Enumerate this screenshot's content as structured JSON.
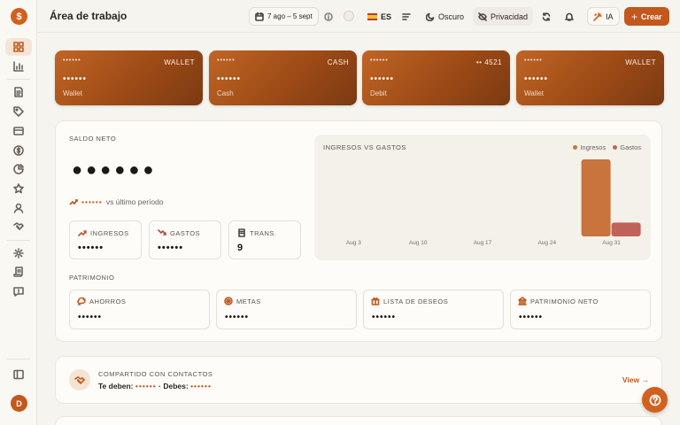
{
  "app": {
    "logo_glyph": "$",
    "user_initial": "D"
  },
  "sidebar": {
    "items": [
      {
        "name": "dashboard",
        "icon": "grid-icon",
        "active": true
      },
      {
        "name": "reports",
        "icon": "bar-chart-icon"
      },
      {
        "name": "transactions",
        "icon": "document-icon"
      },
      {
        "name": "tags",
        "icon": "tag-icon"
      },
      {
        "name": "accounts",
        "icon": "inbox-icon"
      },
      {
        "name": "budget",
        "icon": "dollar-icon"
      },
      {
        "name": "analytics",
        "icon": "pie-icon"
      },
      {
        "name": "favorites",
        "icon": "star-icon"
      },
      {
        "name": "contacts",
        "icon": "user-icon"
      },
      {
        "name": "split",
        "icon": "handshake-icon"
      },
      {
        "name": "settings",
        "icon": "gear-icon"
      },
      {
        "name": "rules",
        "icon": "scroll-icon"
      },
      {
        "name": "feedback",
        "icon": "message-icon"
      }
    ]
  },
  "header": {
    "title": "Área de trabajo",
    "date_range": "7 ago – 5 sept",
    "language": "ES",
    "theme_label": "Oscuro",
    "privacy_label": "Privacidad",
    "ai_label": "IA",
    "create_label": "Crear"
  },
  "cards": [
    {
      "top_mask": "••••••",
      "type": "WALLET",
      "balance": "••••••",
      "name": "Wallet"
    },
    {
      "top_mask": "••••••",
      "type": "CASH",
      "balance": "••••••",
      "name": "Cash"
    },
    {
      "top_mask": "••••••",
      "type": "•• 4521",
      "balance": "••••••",
      "name": "Debit"
    },
    {
      "top_mask": "••••••",
      "type": "WALLET",
      "balance": "••••••",
      "name": "Wallet"
    }
  ],
  "net_balance": {
    "label": "SALDO NETO",
    "value": "●●●●●●",
    "trend_value": "••••••",
    "trend_text": "vs último período"
  },
  "stats": [
    {
      "label": "INGRESOS",
      "value": "••••••",
      "icon": "trending-up-icon",
      "color": "#c3581d"
    },
    {
      "label": "GASTOS",
      "value": "••••••",
      "icon": "trending-down-icon",
      "color": "#b8453a"
    },
    {
      "label": "TRANS.",
      "value": "9",
      "icon": "receipt-icon",
      "color": "#4a433c"
    }
  ],
  "chart_data": {
    "type": "bar",
    "title": "INGRESOS VS GASTOS",
    "categories": [
      "Aug 3",
      "Aug 10",
      "Aug 17",
      "Aug 24",
      "Aug 31"
    ],
    "series": [
      {
        "name": "Ingresos",
        "color": "#c9733d",
        "values": [
          0,
          0,
          0,
          0,
          100
        ]
      },
      {
        "name": "Gastos",
        "color": "#c0625a",
        "values": [
          0,
          0,
          0,
          0,
          18
        ]
      }
    ],
    "ylim": [
      0,
      100
    ],
    "grid": false,
    "legend": "top-right"
  },
  "patrimonio": {
    "label": "PATRIMONIO",
    "items": [
      {
        "label": "AHORROS",
        "value": "••••••",
        "icon": "piggy-bank-icon"
      },
      {
        "label": "METAS",
        "value": "••••••",
        "icon": "target-icon"
      },
      {
        "label": "LISTA DE DESEOS",
        "value": "••••••",
        "icon": "gift-icon"
      },
      {
        "label": "PATRIMONIO NETO",
        "value": "••••••",
        "icon": "bank-icon"
      }
    ]
  },
  "shared": {
    "title": "COMPARTIDO CON CONTACTOS",
    "owed_label": "Te deben:",
    "owed_value": "••••••",
    "sep": "·",
    "owe_label": "Debes:",
    "owe_value": "••••••",
    "view_label": "View →"
  }
}
